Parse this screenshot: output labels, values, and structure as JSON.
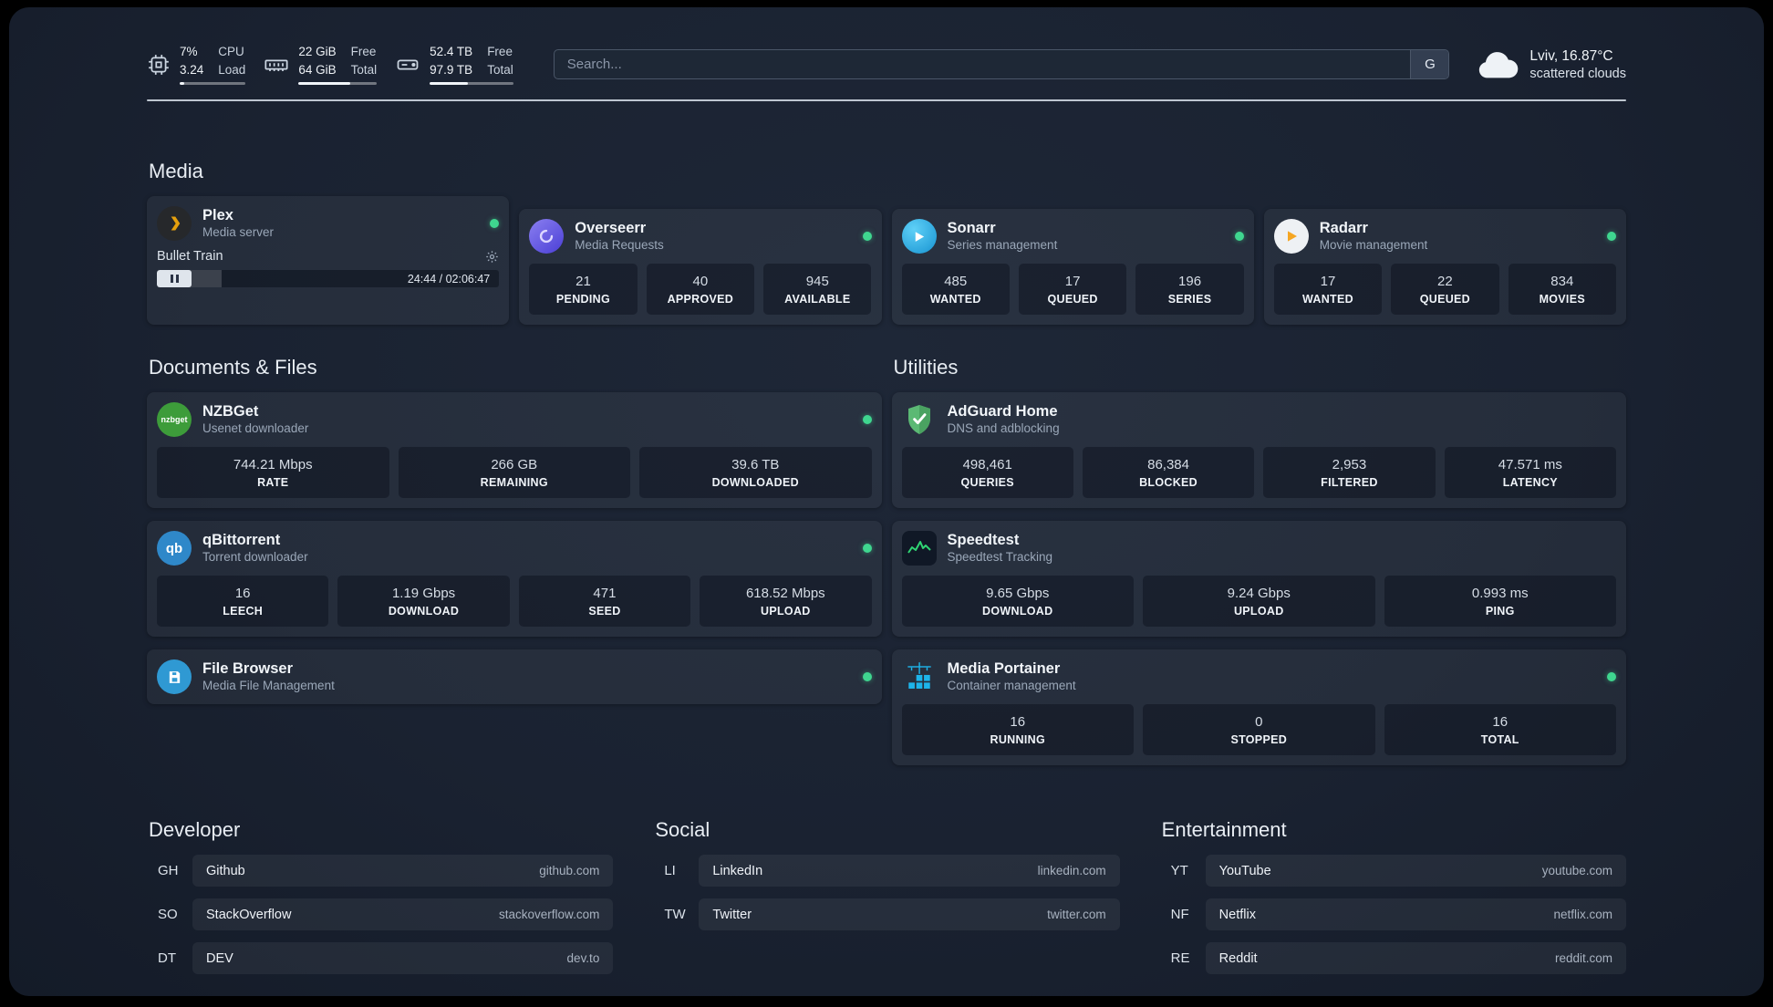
{
  "topbar": {
    "cpu": {
      "usage": "7%",
      "load": "3.24",
      "label1": "CPU",
      "label2": "Load",
      "bar_fill": "7%"
    },
    "memory": {
      "free": "22 GiB",
      "total": "64 GiB",
      "label1": "Free",
      "label2": "Total",
      "bar_fill": "66%"
    },
    "disk": {
      "free": "52.4 TB",
      "total": "97.9 TB",
      "label1": "Free",
      "label2": "Total",
      "bar_fill": "46%"
    },
    "search": {
      "placeholder": "Search...",
      "provider": "G"
    },
    "weather": {
      "location": "Lviv, 16.87°C",
      "condition": "scattered clouds"
    }
  },
  "sections": {
    "media": "Media",
    "documents": "Documents & Files",
    "utilities": "Utilities",
    "developer": "Developer",
    "social": "Social",
    "entertainment": "Entertainment"
  },
  "media": {
    "plex": {
      "name": "Plex",
      "subtitle": "Media server",
      "now_playing": "Bullet Train",
      "time": "24:44 / 02:06:47",
      "progress": "19%"
    },
    "overseerr": {
      "name": "Overseerr",
      "subtitle": "Media Requests",
      "stats": [
        {
          "value": "21",
          "label": "PENDING"
        },
        {
          "value": "40",
          "label": "APPROVED"
        },
        {
          "value": "945",
          "label": "AVAILABLE"
        }
      ]
    },
    "sonarr": {
      "name": "Sonarr",
      "subtitle": "Series management",
      "stats": [
        {
          "value": "485",
          "label": "WANTED"
        },
        {
          "value": "17",
          "label": "QUEUED"
        },
        {
          "value": "196",
          "label": "SERIES"
        }
      ]
    },
    "radarr": {
      "name": "Radarr",
      "subtitle": "Movie management",
      "stats": [
        {
          "value": "17",
          "label": "WANTED"
        },
        {
          "value": "22",
          "label": "QUEUED"
        },
        {
          "value": "834",
          "label": "MOVIES"
        }
      ]
    }
  },
  "documents": {
    "nzbget": {
      "name": "NZBGet",
      "subtitle": "Usenet downloader",
      "icon_text": "nzbget",
      "stats": [
        {
          "value": "744.21 Mbps",
          "label": "RATE"
        },
        {
          "value": "266 GB",
          "label": "REMAINING"
        },
        {
          "value": "39.6 TB",
          "label": "DOWNLOADED"
        }
      ]
    },
    "qbittorrent": {
      "name": "qBittorrent",
      "subtitle": "Torrent downloader",
      "icon_text": "qb",
      "stats": [
        {
          "value": "16",
          "label": "LEECH"
        },
        {
          "value": "1.19 Gbps",
          "label": "DOWNLOAD"
        },
        {
          "value": "471",
          "label": "SEED"
        },
        {
          "value": "618.52 Mbps",
          "label": "UPLOAD"
        }
      ]
    },
    "filebrowser": {
      "name": "File Browser",
      "subtitle": "Media File Management"
    }
  },
  "utilities": {
    "adguard": {
      "name": "AdGuard Home",
      "subtitle": "DNS and adblocking",
      "stats": [
        {
          "value": "498,461",
          "label": "QUERIES"
        },
        {
          "value": "86,384",
          "label": "BLOCKED"
        },
        {
          "value": "2,953",
          "label": "FILTERED"
        },
        {
          "value": "47.571 ms",
          "label": "LATENCY"
        }
      ]
    },
    "speedtest": {
      "name": "Speedtest",
      "subtitle": "Speedtest Tracking",
      "stats": [
        {
          "value": "9.65 Gbps",
          "label": "DOWNLOAD"
        },
        {
          "value": "9.24 Gbps",
          "label": "UPLOAD"
        },
        {
          "value": "0.993 ms",
          "label": "PING"
        }
      ]
    },
    "portainer": {
      "name": "Media Portainer",
      "subtitle": "Container management",
      "stats": [
        {
          "value": "16",
          "label": "RUNNING"
        },
        {
          "value": "0",
          "label": "STOPPED"
        },
        {
          "value": "16",
          "label": "TOTAL"
        }
      ]
    }
  },
  "bookmarks": {
    "developer": [
      {
        "abbr": "GH",
        "name": "Github",
        "domain": "github.com"
      },
      {
        "abbr": "SO",
        "name": "StackOverflow",
        "domain": "stackoverflow.com"
      },
      {
        "abbr": "DT",
        "name": "DEV",
        "domain": "dev.to"
      }
    ],
    "social": [
      {
        "abbr": "LI",
        "name": "LinkedIn",
        "domain": "linkedin.com"
      },
      {
        "abbr": "TW",
        "name": "Twitter",
        "domain": "twitter.com"
      }
    ],
    "entertainment": [
      {
        "abbr": "YT",
        "name": "YouTube",
        "domain": "youtube.com"
      },
      {
        "abbr": "NF",
        "name": "Netflix",
        "domain": "netflix.com"
      },
      {
        "abbr": "RE",
        "name": "Reddit",
        "domain": "reddit.com"
      }
    ]
  },
  "colors": {
    "status_online": "#3fd68f",
    "plex_accent": "#e5a00d",
    "adguard_green": "#5bb974",
    "portainer_blue": "#1db4ea",
    "sonarr_blue": "#35c5f4",
    "radarr_orange": "#f5a623",
    "speedtest_green": "#2fd573"
  },
  "icons": {
    "topbar": [
      "cpu-chip-icon",
      "ram-icon",
      "hard-drive-icon",
      "cloud-icon"
    ],
    "cards": [
      "plex-icon",
      "overseerr-icon",
      "sonarr-icon",
      "radarr-icon",
      "nzbget-icon",
      "qbittorrent-icon",
      "filebrowser-icon",
      "adguard-shield-icon",
      "speedtest-graph-icon",
      "portainer-crane-icon"
    ],
    "misc": [
      "gear-icon",
      "pause-icon",
      "status-dot",
      "search-provider-button"
    ]
  }
}
